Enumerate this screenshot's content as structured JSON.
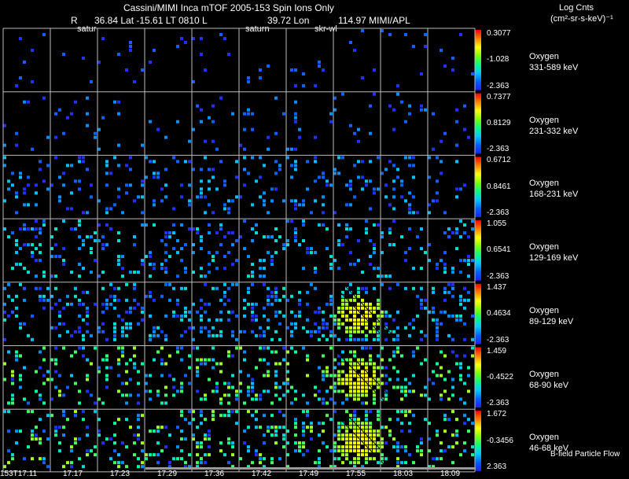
{
  "header": {
    "line1": "Cassini/MIMI Inca mTOF  2005-153   Spin    Ions Only",
    "line2_R": "R",
    "line2_coords": "36.84  Lat -15.61 LT 0810 L",
    "line2_lon": "39.72 Lon",
    "line2_right": "114.97   MIMI/APL",
    "units_title": "Log Cnts",
    "units": "(cm²-sr-s-keV)⁻¹",
    "saturn_labels": [
      "satur",
      "saturn",
      "skr-wl"
    ],
    "footer_note": "B-field Particle Flow"
  },
  "chart_data": {
    "type": "heatmap",
    "title": "Cassini/MIMI Inca mTOF  2005-153   Spin    Ions Only",
    "x_tick_labels": [
      "153T17:11",
      "17:17",
      "17:23",
      "17:29",
      "17:36",
      "17:42",
      "17:49",
      "17:55",
      "18:03",
      "18:09"
    ],
    "colorbar_colors": [
      "#ff0000",
      "#ff8000",
      "#ffff00",
      "#80ff00",
      "#00ff80",
      "#00c8ff",
      "#0060ff",
      "#2020ff"
    ],
    "panels": [
      {
        "species": "Oxygen",
        "energy": "331-589 keV",
        "cmax": "0.3077",
        "cmid": "-1.028",
        "cmin": "-2.363",
        "density": 0.03,
        "peak": 0
      },
      {
        "species": "Oxygen",
        "energy": "231-332 keV",
        "cmax": "0.7377",
        "cmid": "0.8129",
        "cmin": "-2.363",
        "density": 0.06,
        "peak": 0
      },
      {
        "species": "Oxygen",
        "energy": "168-231 keV",
        "cmax": "0.6712",
        "cmid": "0.8461",
        "cmin": "-2.363",
        "density": 0.12,
        "peak": 0.1
      },
      {
        "species": "Oxygen",
        "energy": "129-169 keV",
        "cmax": "1.055",
        "cmid": "0.6541",
        "cmin": "-2.363",
        "density": 0.16,
        "peak": 0.2
      },
      {
        "species": "Oxygen",
        "energy": "89-129 keV",
        "cmax": "1.437",
        "cmid": "0.4634",
        "cmin": "-2.363",
        "density": 0.22,
        "peak": 0.7
      },
      {
        "species": "Oxygen",
        "energy": "68-90 keV",
        "cmax": "1.459",
        "cmid": "-0.4522",
        "cmin": "-2.363",
        "density": 0.2,
        "peak": 0.85
      },
      {
        "species": "Oxygen",
        "energy": "46-68 keV",
        "cmax": "1.672",
        "cmid": "-0.3456",
        "cmin": "2.363",
        "density": 0.2,
        "peak": 0.9
      }
    ]
  }
}
